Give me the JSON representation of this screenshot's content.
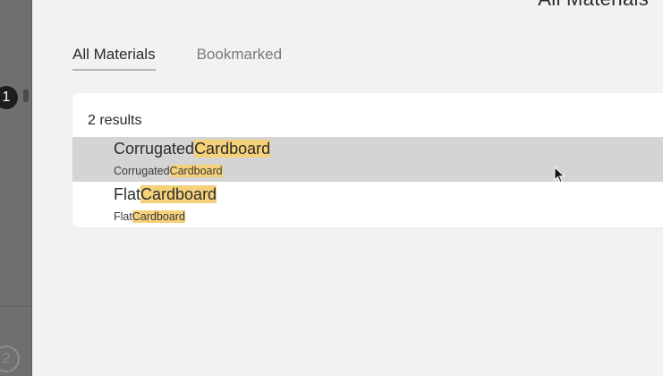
{
  "panel": {
    "title": "All Materials"
  },
  "background": {
    "step_1": "1",
    "step_2": "2"
  },
  "tabs": [
    {
      "label": "All Materials",
      "active": true
    },
    {
      "label": "Bookmarked",
      "active": false
    }
  ],
  "results": {
    "count_label": "2 results",
    "items": [
      {
        "name_prefix": "Corrugated",
        "name_match": "Cardboard",
        "path_prefix": "Corrugated",
        "path_match": "Cardboard",
        "hovered": true
      },
      {
        "name_prefix": "Flat",
        "name_match": "Cardboard",
        "path_prefix": "Flat",
        "path_match": "Cardboard",
        "hovered": false
      }
    ]
  },
  "colors": {
    "highlight": "#f5d27a",
    "hover_row": "#d4d4d4",
    "panel_bg": "#f2f2f2",
    "backdrop": "#6f6f6f"
  },
  "icons": {
    "cursor": "mouse-pointer-icon"
  }
}
